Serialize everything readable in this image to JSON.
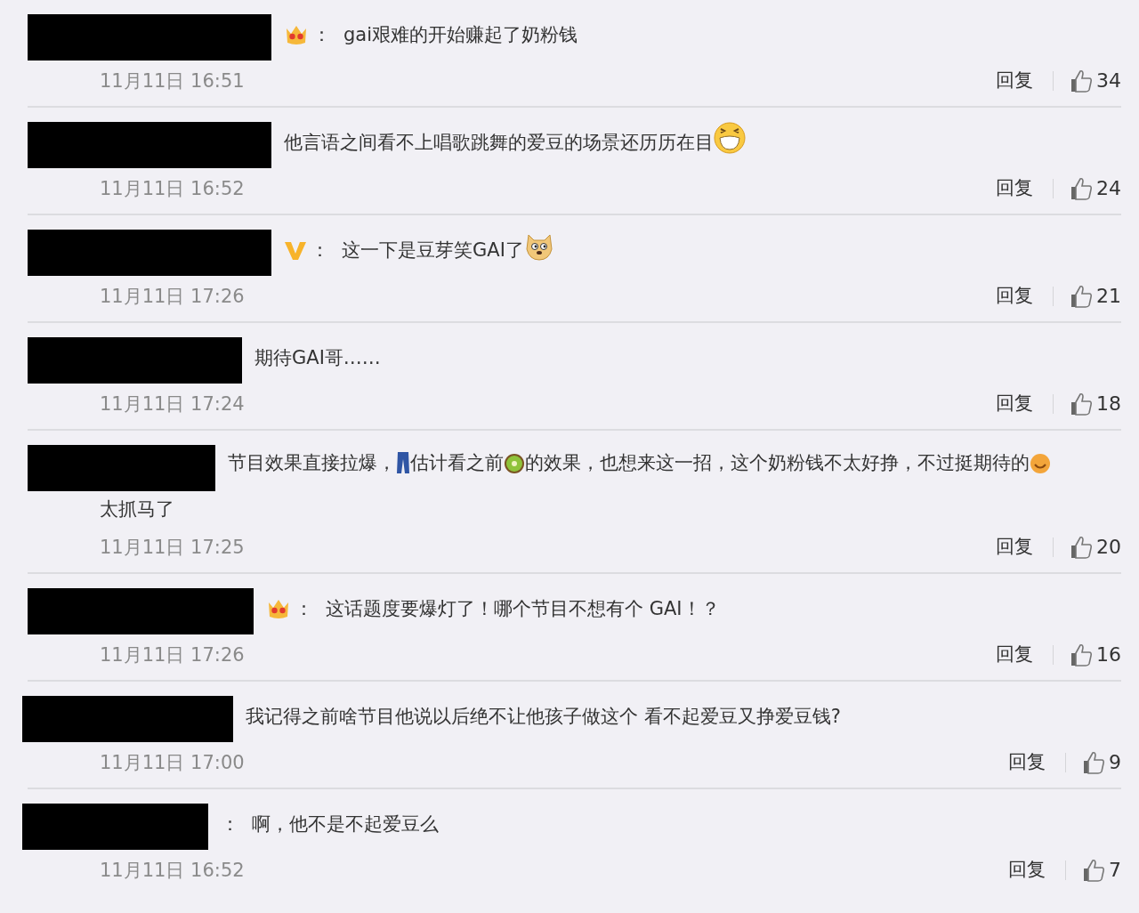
{
  "comments": [
    {
      "parts": [
        {
          "kind": "crown"
        },
        {
          "kind": "text",
          "text": "："
        },
        {
          "kind": "text",
          "text": "gai艰难的开始赚起了奶粉钱"
        }
      ],
      "time": "11月11日 16:51",
      "reply": "回复",
      "likes": "34"
    },
    {
      "parts": [
        {
          "kind": "text",
          "text": "他言语之间看不上唱歌跳舞的爱豆的场景还历历在目"
        },
        {
          "kind": "grin"
        }
      ],
      "time": "11月11日 16:52",
      "reply": "回复",
      "likes": "24"
    },
    {
      "parts": [
        {
          "kind": "vbadge"
        },
        {
          "kind": "text",
          "text": "："
        },
        {
          "kind": "text",
          "text": "这一下是豆芽笑GAI了"
        },
        {
          "kind": "doge"
        }
      ],
      "time": "11月11日 17:26",
      "reply": "回复",
      "likes": "21"
    },
    {
      "parts": [
        {
          "kind": "text",
          "text": "期待GAI哥……"
        }
      ],
      "time": "11月11日 17:24",
      "reply": "回复",
      "likes": "18"
    },
    {
      "parts": [
        {
          "kind": "text",
          "text": "节目效果直接拉爆，"
        },
        {
          "kind": "jeans"
        },
        {
          "kind": "text",
          "text": "估计看之前"
        },
        {
          "kind": "kiwi"
        },
        {
          "kind": "text",
          "text": "的效果，也想来这一招，这个奶粉钱不太好挣，不过挺期待的"
        },
        {
          "kind": "smile"
        },
        {
          "kind": "text",
          "text": "太抓马了"
        }
      ],
      "time": "11月11日 17:25",
      "reply": "回复",
      "likes": "20"
    },
    {
      "parts": [
        {
          "kind": "crown"
        },
        {
          "kind": "text",
          "text": "："
        },
        {
          "kind": "text",
          "text": "这话题度要爆灯了！哪个节目不想有个 GAI！？"
        }
      ],
      "time": "11月11日 17:26",
      "reply": "回复",
      "likes": "16"
    },
    {
      "parts": [
        {
          "kind": "text",
          "text": "我记得之前啥节目他说以后绝不让他孩子做这个 看不起爱豆又挣爱豆钱?"
        }
      ],
      "time": "11月11日 17:00",
      "reply": "回复",
      "likes": "9"
    },
    {
      "parts": [
        {
          "kind": "text",
          "text": "："
        },
        {
          "kind": "text",
          "text": "啊，他不是不起爱豆么"
        }
      ],
      "time": "11月11日 16:52",
      "reply": "回复",
      "likes": "7"
    }
  ]
}
